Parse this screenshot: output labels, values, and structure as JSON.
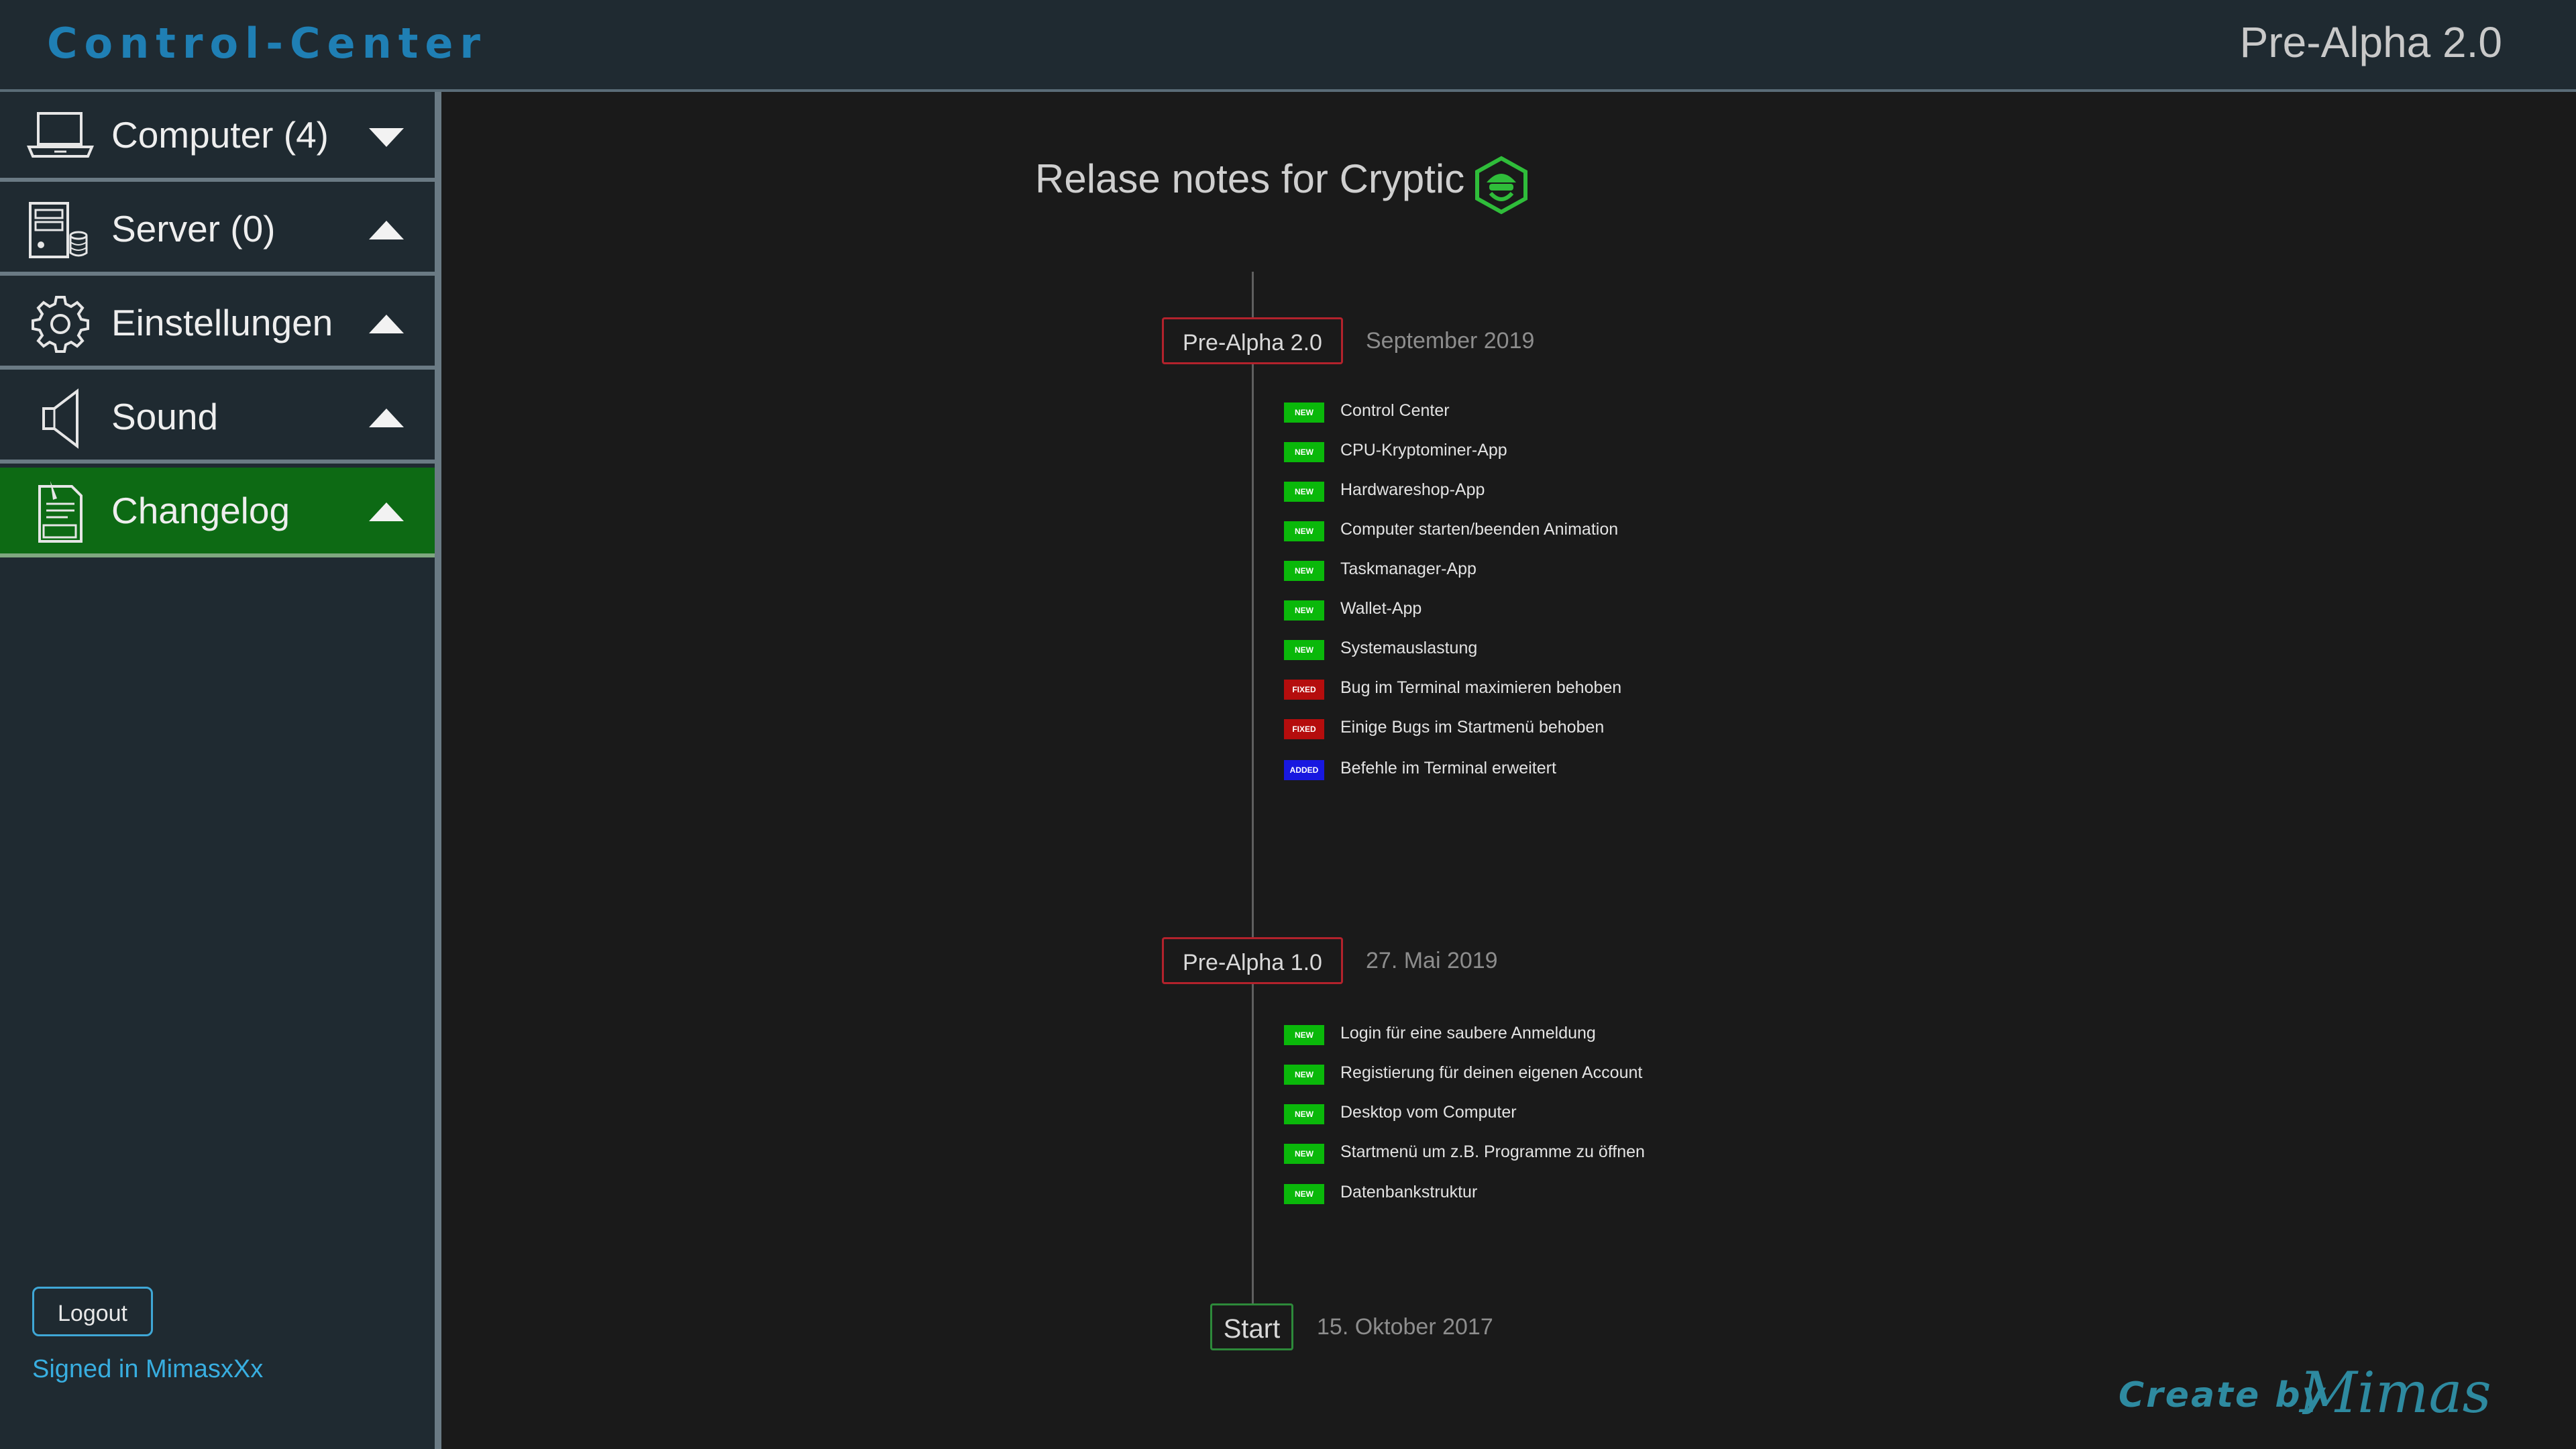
{
  "header": {
    "brand": "Control-Center",
    "version": "Pre-Alpha 2.0"
  },
  "sidebar": {
    "items": [
      {
        "label": "Computer (4)",
        "icon": "laptop-icon",
        "arrow": "down",
        "active": false
      },
      {
        "label": "Server (0)",
        "icon": "server-icon",
        "arrow": "up",
        "active": false
      },
      {
        "label": "Einstellungen",
        "icon": "gear-icon",
        "arrow": "up",
        "active": false
      },
      {
        "label": "Sound",
        "icon": "speaker-icon",
        "arrow": "up",
        "active": false
      },
      {
        "label": "Changelog",
        "icon": "log-icon",
        "arrow": "up",
        "active": true
      }
    ],
    "logout_label": "Logout",
    "signed_in": "Signed in MimasxXx"
  },
  "main": {
    "title": "Relase notes for Cryptic",
    "releases": [
      {
        "version": "Pre-Alpha 2.0",
        "date": "September 2019",
        "entries": [
          {
            "tag": "NEW",
            "text": "Control Center"
          },
          {
            "tag": "NEW",
            "text": "CPU-Kryptominer-App"
          },
          {
            "tag": "NEW",
            "text": "Hardwareshop-App"
          },
          {
            "tag": "NEW",
            "text": "Computer starten/beenden Animation"
          },
          {
            "tag": "NEW",
            "text": "Taskmanager-App"
          },
          {
            "tag": "NEW",
            "text": "Wallet-App"
          },
          {
            "tag": "NEW",
            "text": "Systemauslastung"
          },
          {
            "tag": "FIXED",
            "text": "Bug im Terminal maximieren behoben"
          },
          {
            "tag": "FIXED",
            "text": "Einige Bugs im Startmenü behoben"
          },
          {
            "tag": "ADDED",
            "text": "Befehle im Terminal erweitert"
          }
        ]
      },
      {
        "version": "Pre-Alpha 1.0",
        "date": "27. Mai 2019",
        "entries": [
          {
            "tag": "NEW",
            "text": "Login für eine saubere Anmeldung"
          },
          {
            "tag": "NEW",
            "text": "Registierung für deinen eigenen Account"
          },
          {
            "tag": "NEW",
            "text": "Desktop vom Computer"
          },
          {
            "tag": "NEW",
            "text": "Startmenü um z.B. Programme zu öffnen"
          },
          {
            "tag": "NEW",
            "text": "Datenbankstruktur"
          }
        ]
      },
      {
        "version": "Start",
        "date": "15. Oktober 2017",
        "entries": []
      }
    ],
    "credit": {
      "prefix": "Create by",
      "name": "Mimas"
    }
  },
  "colors": {
    "brand": "#1f7fb4",
    "active_nav": "#0d6a14",
    "new": "#0ab80a",
    "fixed": "#b50d0d",
    "added": "#1818e0",
    "credit": "#2e8aa0"
  }
}
